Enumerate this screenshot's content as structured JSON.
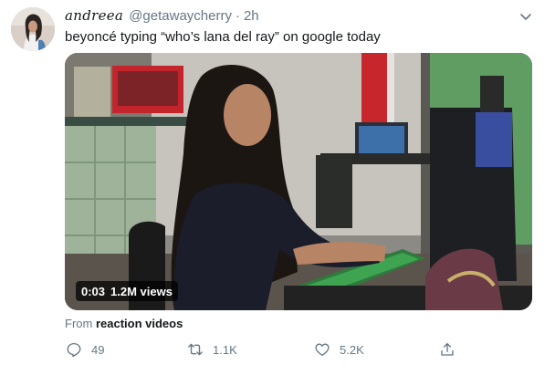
{
  "tweet": {
    "display_name": "andreea",
    "handle": "@getawaycherry",
    "separator": "·",
    "time": "2h",
    "text": "beyoncé typing “who’s lana del ray” on google today"
  },
  "media": {
    "duration": "0:03",
    "views": "1.2M views"
  },
  "source": {
    "prefix": "From",
    "link": "reaction videos"
  },
  "actions": {
    "reply_count": "49",
    "retweet_count": "1.1K",
    "like_count": "5.2K"
  },
  "icons": {
    "caret": "chevron-down-icon",
    "reply": "reply-icon",
    "retweet": "retweet-icon",
    "like": "heart-icon",
    "share": "share-icon"
  },
  "colors": {
    "text_primary": "#14171a",
    "text_secondary": "#657786",
    "background": "#ffffff"
  }
}
